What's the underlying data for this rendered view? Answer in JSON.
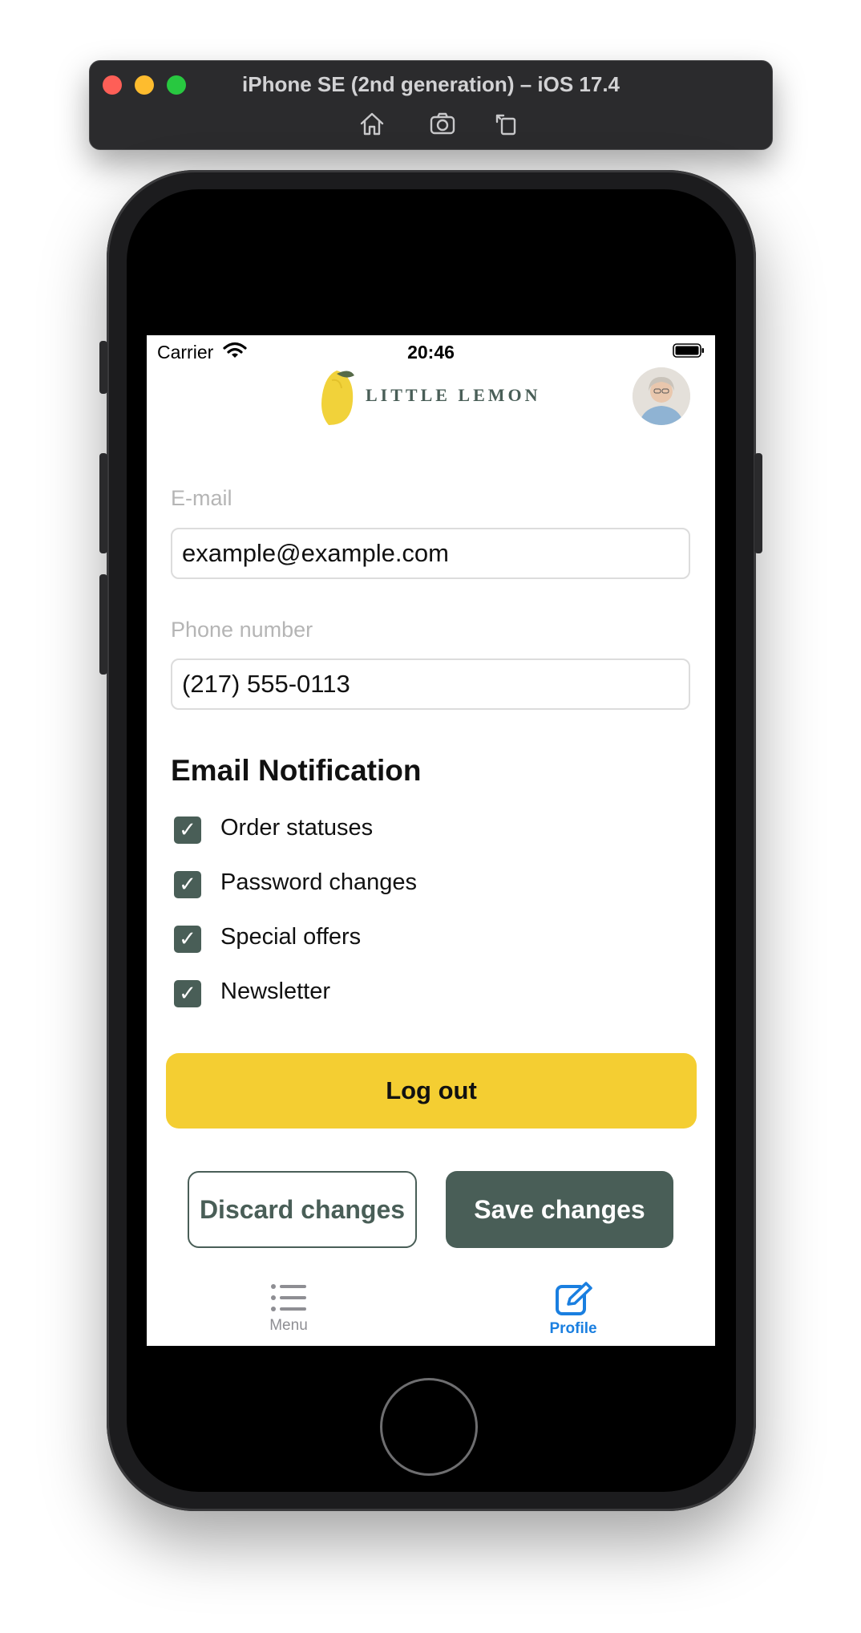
{
  "simulator": {
    "title": "iPhone SE (2nd generation) – iOS 17.4",
    "tools": [
      "home-icon",
      "screenshot-icon",
      "rotate-icon"
    ]
  },
  "status_bar": {
    "carrier": "Carrier",
    "time": "20:46"
  },
  "header": {
    "logo_text": "LITTLE LEMON",
    "avatar": "profile-avatar"
  },
  "form": {
    "email_label": "E-mail",
    "email_value": "example@example.com",
    "phone_label": "Phone number",
    "phone_value": "(217) 555-0113"
  },
  "notifications": {
    "title": "Email Notification",
    "items": [
      {
        "label": "Order statuses",
        "checked": true
      },
      {
        "label": "Password changes",
        "checked": true
      },
      {
        "label": "Special offers",
        "checked": true
      },
      {
        "label": "Newsletter",
        "checked": true
      }
    ]
  },
  "actions": {
    "logout": "Log out",
    "discard": "Discard changes",
    "save": "Save changes"
  },
  "tab_bar": {
    "tabs": [
      {
        "label": "Menu",
        "icon": "list-icon",
        "active": false
      },
      {
        "label": "Profile",
        "icon": "edit-icon",
        "active": true
      }
    ]
  },
  "colors": {
    "primary_green": "#495e57",
    "primary_yellow": "#f4ce32",
    "tab_active": "#1a7fe0",
    "tab_inactive": "#8e8e93"
  }
}
